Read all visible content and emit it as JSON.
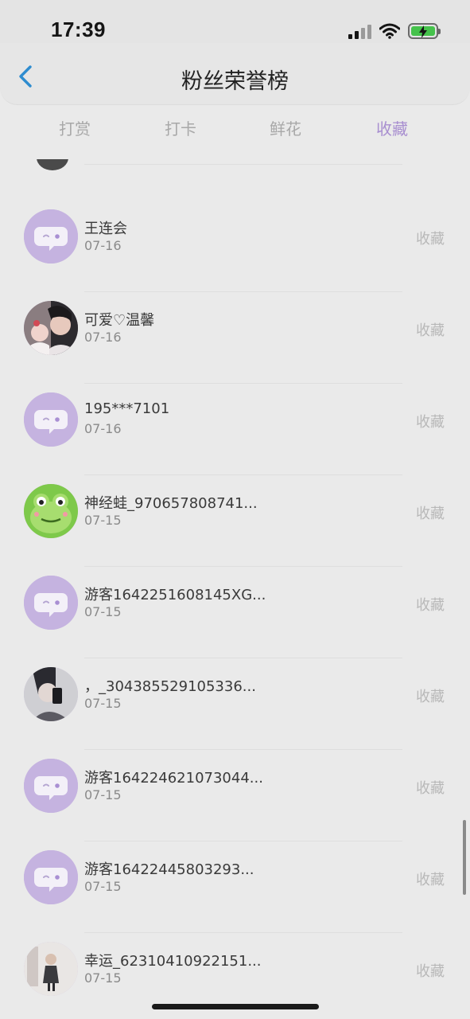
{
  "status": {
    "time": "17:39"
  },
  "header": {
    "title": "粉丝荣誉榜"
  },
  "tabs": [
    {
      "label": "打赏",
      "active": false
    },
    {
      "label": "打卡",
      "active": false
    },
    {
      "label": "鲜花",
      "active": false
    },
    {
      "label": "收藏",
      "active": true
    }
  ],
  "colors": {
    "accent": "#a88ed0",
    "default_avatar": "#c5b3e0",
    "battery": "#45c24b"
  },
  "rows": [
    {
      "name": "王连会",
      "date": "07-16",
      "action": "收藏",
      "avatar": "chat-bubble-icon"
    },
    {
      "name": "可爱♡温馨",
      "date": "07-16",
      "action": "收藏",
      "avatar": "photo-portrait"
    },
    {
      "name": "195***7101",
      "date": "07-16",
      "action": "收藏",
      "avatar": "chat-bubble-icon"
    },
    {
      "name": "神经蛙_970657808741...",
      "date": "07-15",
      "action": "收藏",
      "avatar": "frog-icon"
    },
    {
      "name": "游客1642251608145XG...",
      "date": "07-15",
      "action": "收藏",
      "avatar": "chat-bubble-icon"
    },
    {
      "name": "，_304385529105336...",
      "date": "07-15",
      "action": "收藏",
      "avatar": "photo-portrait-dark"
    },
    {
      "name": "游客164224621073044...",
      "date": "07-15",
      "action": "收藏",
      "avatar": "chat-bubble-icon"
    },
    {
      "name": "游客16422445803293...",
      "date": "07-15",
      "action": "收藏",
      "avatar": "chat-bubble-icon"
    },
    {
      "name": "幸运_62310410922151...",
      "date": "07-15",
      "action": "收藏",
      "avatar": "photo-figure"
    }
  ]
}
